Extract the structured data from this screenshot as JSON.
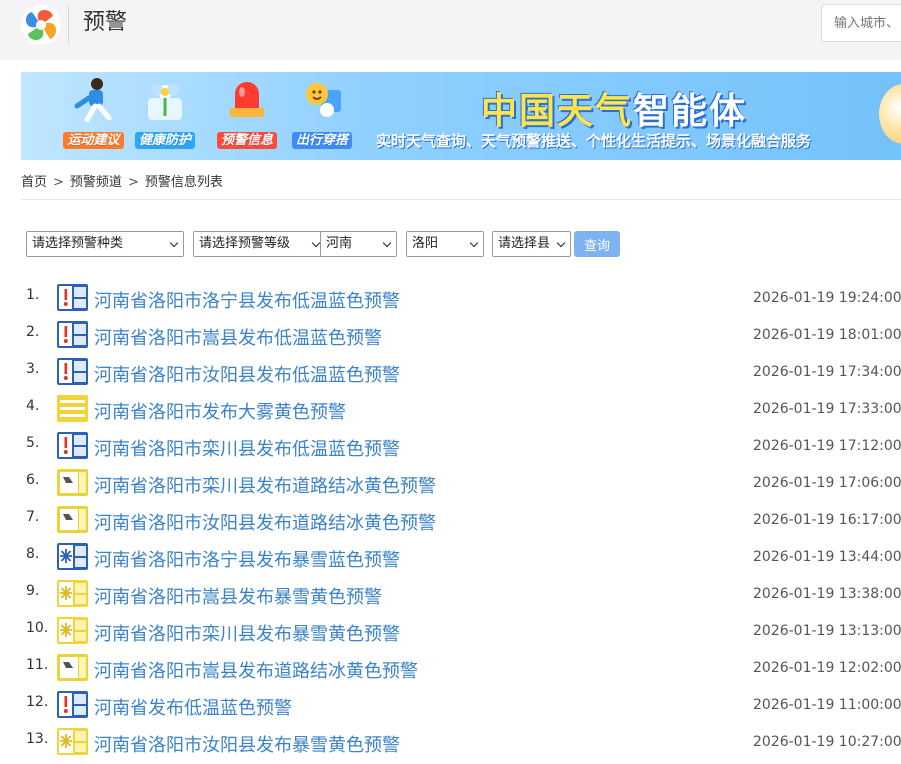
{
  "header": {
    "logo_icon": "pinwheel-logo-icon",
    "title": "预警",
    "search_placeholder": "输入城市、"
  },
  "banner": {
    "items": [
      {
        "label": "运动建议",
        "icon": "running-person-icon"
      },
      {
        "label": "健康防护",
        "icon": "flower-icon"
      },
      {
        "label": "预警信息",
        "icon": "siren-icon"
      },
      {
        "label": "出行穿搭",
        "icon": "sun-icon"
      }
    ],
    "title_yellow": "中国天气",
    "title_white": "智能体",
    "subtitle": "实时天气查询、天气预警推送、个性化生活提示、场景化融合服务"
  },
  "breadcrumb": {
    "home": "首页",
    "channel": "预警频道",
    "current": "预警信息列表",
    "separator": ">"
  },
  "filters": {
    "type": "请选择预警种类",
    "level": "请选择预警等级",
    "province": "河南",
    "city": "洛阳",
    "county": "请选择县",
    "query_label": "查询"
  },
  "colors": {
    "link": "#3b83c8",
    "query_button": "#7fb2f1",
    "blue_alert": "#2b62b8",
    "yellow_alert": "#f2d33a"
  },
  "alerts": [
    {
      "index": "1.",
      "icon": "low-temperature-blue-icon",
      "title": "河南省洛阳市洛宁县发布低温蓝色预警",
      "time": "2026-01-19 19:24:00"
    },
    {
      "index": "2.",
      "icon": "low-temperature-blue-icon",
      "title": "河南省洛阳市嵩县发布低温蓝色预警",
      "time": "2026-01-19 18:01:00"
    },
    {
      "index": "3.",
      "icon": "low-temperature-blue-icon",
      "title": "河南省洛阳市汝阳县发布低温蓝色预警",
      "time": "2026-01-19 17:34:00"
    },
    {
      "index": "4.",
      "icon": "heavy-fog-yellow-icon",
      "title": "河南省洛阳市发布大雾黄色预警",
      "time": "2026-01-19 17:33:00"
    },
    {
      "index": "5.",
      "icon": "low-temperature-blue-icon",
      "title": "河南省洛阳市栾川县发布低温蓝色预警",
      "time": "2026-01-19 17:12:00"
    },
    {
      "index": "6.",
      "icon": "road-icing-yellow-icon",
      "title": "河南省洛阳市栾川县发布道路结冰黄色预警",
      "time": "2026-01-19 17:06:00"
    },
    {
      "index": "7.",
      "icon": "road-icing-yellow-icon",
      "title": "河南省洛阳市汝阳县发布道路结冰黄色预警",
      "time": "2026-01-19 16:17:00"
    },
    {
      "index": "8.",
      "icon": "snowstorm-blue-icon",
      "title": "河南省洛阳市洛宁县发布暴雪蓝色预警",
      "time": "2026-01-19 13:44:00"
    },
    {
      "index": "9.",
      "icon": "snowstorm-yellow-icon",
      "title": "河南省洛阳市嵩县发布暴雪黄色预警",
      "time": "2026-01-19 13:38:00"
    },
    {
      "index": "10.",
      "icon": "snowstorm-yellow-icon",
      "title": "河南省洛阳市栾川县发布暴雪黄色预警",
      "time": "2026-01-19 13:13:00"
    },
    {
      "index": "11.",
      "icon": "road-icing-yellow-icon",
      "title": "河南省洛阳市嵩县发布道路结冰黄色预警",
      "time": "2026-01-19 12:02:00"
    },
    {
      "index": "12.",
      "icon": "low-temperature-blue-icon",
      "title": "河南省发布低温蓝色预警",
      "time": "2026-01-19 11:00:00"
    },
    {
      "index": "13.",
      "icon": "snowstorm-yellow-icon",
      "title": "河南省洛阳市汝阳县发布暴雪黄色预警",
      "time": "2026-01-19 10:27:00"
    }
  ]
}
